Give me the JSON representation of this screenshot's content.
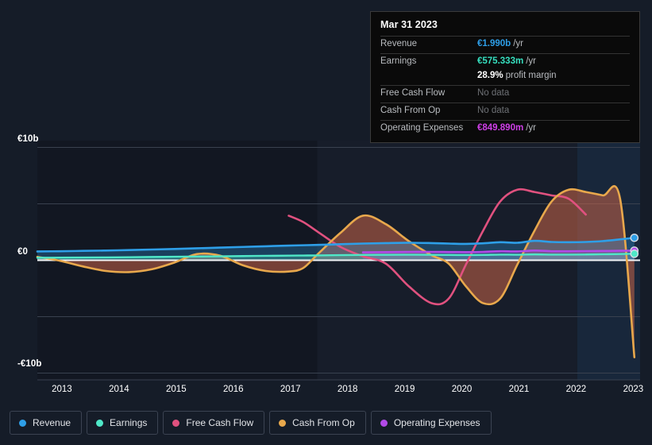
{
  "tooltip": {
    "date": "Mar 31 2023",
    "rows": [
      {
        "label": "Revenue",
        "value": "€1.990b",
        "unit": "/yr",
        "color": "#2e9fe8",
        "nodata": false
      },
      {
        "label": "Earnings",
        "value": "€575.333m",
        "unit": "/yr",
        "color": "#36e0c0",
        "nodata": false
      },
      {
        "label": "",
        "value": "28.9%",
        "unit": "profit margin",
        "color": "#ffffff",
        "nodata": false
      },
      {
        "label": "Free Cash Flow",
        "value": "No data",
        "unit": "",
        "color": "#6e7176",
        "nodata": true
      },
      {
        "label": "Cash From Op",
        "value": "No data",
        "unit": "",
        "color": "#6e7176",
        "nodata": true
      },
      {
        "label": "Operating Expenses",
        "value": "€849.890m",
        "unit": "/yr",
        "color": "#cf3fe8",
        "nodata": false
      }
    ]
  },
  "legend": {
    "items": [
      {
        "label": "Revenue",
        "color": "#2e9fe8"
      },
      {
        "label": "Earnings",
        "color": "#4fe8c8"
      },
      {
        "label": "Free Cash Flow",
        "color": "#e0517f"
      },
      {
        "label": "Cash From Op",
        "color": "#e8a84c"
      },
      {
        "label": "Operating Expenses",
        "color": "#b24ae8"
      }
    ]
  },
  "chart_data": {
    "type": "area",
    "title": "",
    "xlabel": "",
    "ylabel": "",
    "ylim": [
      -10,
      10
    ],
    "ytick_labels": [
      "€10b",
      "€0",
      "-€10b"
    ],
    "ytick_values": [
      10,
      0,
      -10
    ],
    "gridlines": [
      10,
      5,
      0,
      -5,
      -10
    ],
    "grid": true,
    "legend_position": "bottom-left",
    "currency": "EUR",
    "units": "billions",
    "x_tick_labels": [
      "2013",
      "2014",
      "2015",
      "2016",
      "2017",
      "2018",
      "2019",
      "2020",
      "2021",
      "2022",
      "2023"
    ],
    "x": [
      2012.6,
      2013,
      2013.4,
      2013.8,
      2014.2,
      2014.6,
      2015,
      2015.4,
      2015.8,
      2016.2,
      2016.6,
      2017,
      2017.25,
      2017.5,
      2017.9,
      2018.3,
      2018.7,
      2019.1,
      2019.5,
      2019.8,
      2020.1,
      2020.4,
      2020.7,
      2021,
      2021.3,
      2021.6,
      2021.9,
      2022.2,
      2022.5,
      2022.8,
      2023.05
    ],
    "series": [
      {
        "name": "Revenue",
        "color": "#2e9fe8",
        "values": [
          0.78,
          0.8,
          0.83,
          0.86,
          0.9,
          0.95,
          1.0,
          1.06,
          1.12,
          1.18,
          1.24,
          1.3,
          1.33,
          1.36,
          1.42,
          1.48,
          1.52,
          1.55,
          1.52,
          1.48,
          1.45,
          1.5,
          1.6,
          1.55,
          1.72,
          1.62,
          1.6,
          1.62,
          1.7,
          1.85,
          1.99
        ]
      },
      {
        "name": "Earnings",
        "color": "#4fe8c8",
        "values": [
          0.22,
          0.23,
          0.24,
          0.25,
          0.27,
          0.29,
          0.31,
          0.33,
          0.35,
          0.37,
          0.39,
          0.41,
          0.42,
          0.43,
          0.45,
          0.47,
          0.48,
          0.49,
          0.48,
          0.47,
          0.46,
          0.47,
          0.5,
          0.49,
          0.52,
          0.5,
          0.5,
          0.51,
          0.53,
          0.55,
          0.575
        ]
      },
      {
        "name": "Free Cash Flow",
        "color": "#e0517f",
        "values": [
          null,
          null,
          null,
          null,
          null,
          null,
          null,
          null,
          null,
          null,
          null,
          3.95,
          3.4,
          2.55,
          1.2,
          0.35,
          -0.3,
          -2.3,
          -3.8,
          -3.4,
          -0.4,
          2.6,
          5.2,
          6.25,
          6.05,
          5.75,
          5.45,
          4.05,
          null,
          null,
          null
        ]
      },
      {
        "name": "Cash From Op",
        "color": "#e8a84c",
        "values": [
          0.3,
          -0.05,
          -0.55,
          -0.95,
          -1.05,
          -0.8,
          -0.2,
          0.55,
          0.4,
          -0.45,
          -0.95,
          -1.0,
          -0.7,
          0.5,
          2.4,
          3.95,
          3.2,
          1.7,
          0.45,
          -0.3,
          -2.3,
          -3.8,
          -3.4,
          -0.4,
          2.6,
          5.2,
          6.25,
          6.05,
          5.75,
          5.45,
          -8.6
        ]
      },
      {
        "name": "Operating Expenses",
        "color": "#b24ae8",
        "values": [
          null,
          null,
          null,
          null,
          null,
          null,
          null,
          null,
          null,
          null,
          null,
          null,
          null,
          null,
          null,
          0.7,
          0.72,
          0.74,
          0.74,
          0.73,
          0.72,
          0.74,
          0.8,
          0.78,
          0.86,
          0.8,
          0.8,
          0.81,
          0.82,
          0.84,
          0.85
        ]
      }
    ],
    "annotations": [
      {
        "type": "highlight-band",
        "label": "forecast-region",
        "x_start": 2022.05,
        "x_end": 2023.15
      },
      {
        "type": "highlight-band",
        "label": "selection-region",
        "x_start": 2017.5,
        "x_end": 2022.05
      }
    ]
  }
}
